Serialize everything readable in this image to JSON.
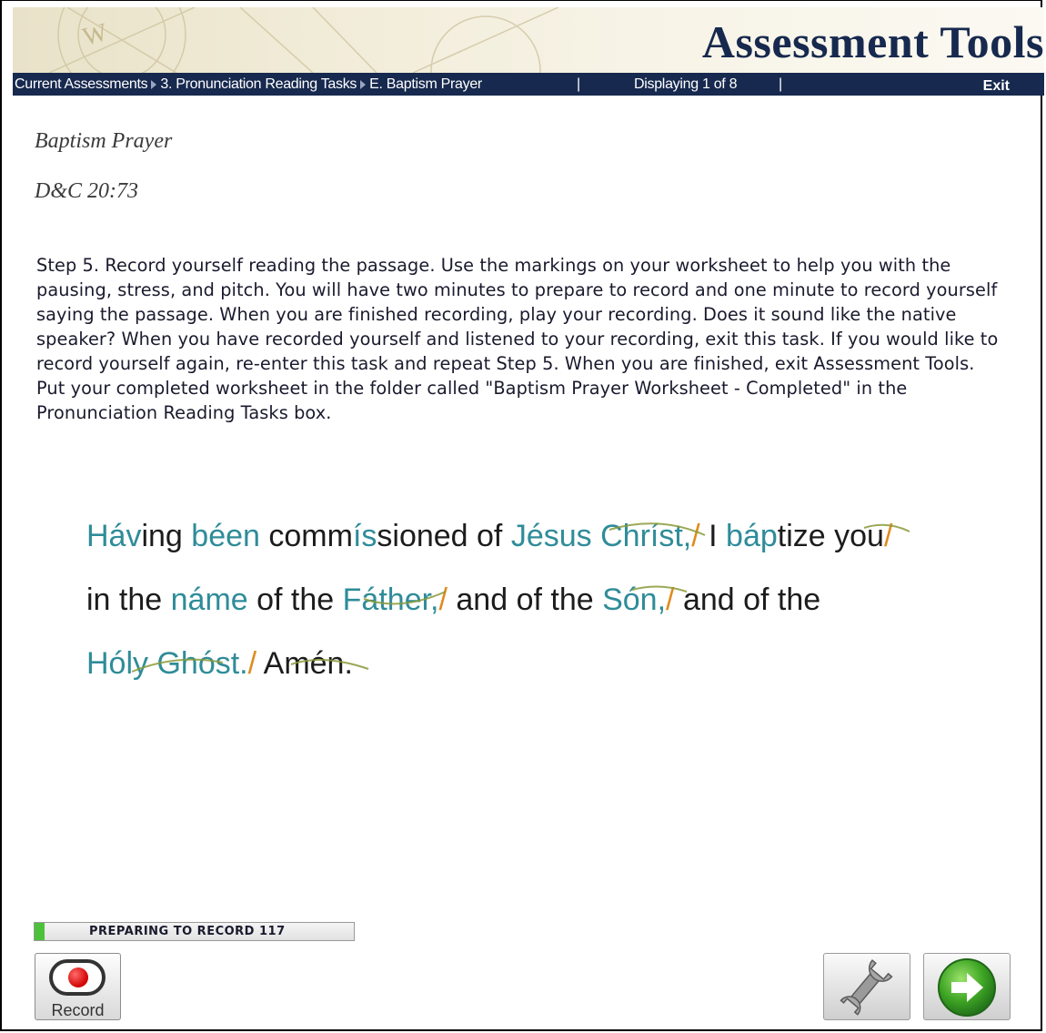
{
  "header": {
    "title": "Assessment Tools"
  },
  "navbar": {
    "breadcrumb": [
      "Current Assessments",
      "3. Pronunciation Reading Tasks",
      "E. Baptism Prayer"
    ],
    "pipe": "|",
    "display_status": "Displaying 1 of 8",
    "exit_label": "Exit"
  },
  "content": {
    "title": "Baptism Prayer",
    "reference": "D&C 20:73",
    "instructions": "Step 5. Record yourself reading the passage. Use the markings on your worksheet to help you with the pausing, stress, and pitch. You will have two minutes to prepare to record and one minute to record yourself saying the passage. When you are finished recording, play your recording. Does it sound like the native speaker? When you have recorded yourself and listened to your recording, exit this task. If you would like to record yourself again, re-enter this task and repeat Step 5. When you are finished, exit Assessment Tools. Put your completed worksheet in the folder called \"Baptism Prayer Worksheet - Completed\" in the Pronunciation Reading Tasks box."
  },
  "passage": {
    "line1": [
      "Háv",
      "ing ",
      "béen",
      " comm",
      "ís",
      "sioned of ",
      "Jésus Chríst,",
      "/",
      " I ",
      "báp",
      "tize you",
      "/"
    ],
    "line2": [
      "in the ",
      "náme",
      " of the ",
      "Fáther,",
      "/",
      " and of the ",
      "Són,",
      "/",
      " and of the"
    ],
    "line3": [
      "Hóly Ghóst.",
      "/",
      " Amén."
    ]
  },
  "recorder": {
    "status_text": "PREPARING TO RECORD 117",
    "progress_fraction": 0.03,
    "record_label": "Record"
  },
  "colors": {
    "navy": "#17294e",
    "stress_teal": "#2f8c99",
    "pause_orange": "#e08a1e",
    "progress_green": "#4cc23a"
  },
  "icons": {
    "record": "record-icon",
    "tools": "wrench-icon",
    "next": "next-arrow-icon"
  }
}
